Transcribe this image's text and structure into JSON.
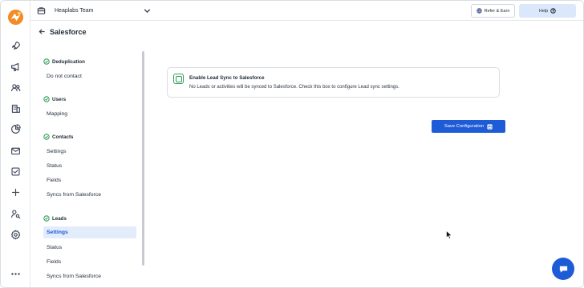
{
  "header": {
    "team_name": "Heaplabs Team",
    "refer_label": "Refer & Earn",
    "help_label": "Help"
  },
  "page": {
    "title": "Salesforce"
  },
  "sidenav": {
    "groups": [
      {
        "title": "Deduplication",
        "items": [
          {
            "label": "Do not contact",
            "active": false
          }
        ]
      },
      {
        "title": "Users",
        "items": [
          {
            "label": "Mapping",
            "active": false
          }
        ]
      },
      {
        "title": "Contacts",
        "items": [
          {
            "label": "Settings",
            "active": false
          },
          {
            "label": "Status",
            "active": false
          },
          {
            "label": "Fields",
            "active": false
          },
          {
            "label": "Syncs from Salesforce",
            "active": false
          }
        ]
      },
      {
        "title": "Leads",
        "items": [
          {
            "label": "Settings",
            "active": true
          },
          {
            "label": "Status",
            "active": false
          },
          {
            "label": "Fields",
            "active": false
          },
          {
            "label": "Syncs from Salesforce",
            "active": false
          }
        ]
      }
    ]
  },
  "lead_sync": {
    "checkbox_label": "Enable Lead Sync to Salesforce",
    "description": "No Leads or activities will be synced to Salesforce. Check this box to configure Lead sync settings.",
    "checked": false
  },
  "actions": {
    "save_label": "Save Configuration"
  },
  "colors": {
    "accent": "#1e5bd7",
    "success": "#2e9e57",
    "active_bg": "#e3ecfb",
    "help_bg": "#dbe7fb"
  },
  "icons": {
    "rail": [
      "rocket-icon",
      "megaphone-icon",
      "users-icon",
      "building-icon",
      "pie-chart-icon",
      "mail-icon",
      "task-check-icon",
      "plus-icon",
      "person-search-icon",
      "settings-icon",
      "more-icon"
    ]
  }
}
